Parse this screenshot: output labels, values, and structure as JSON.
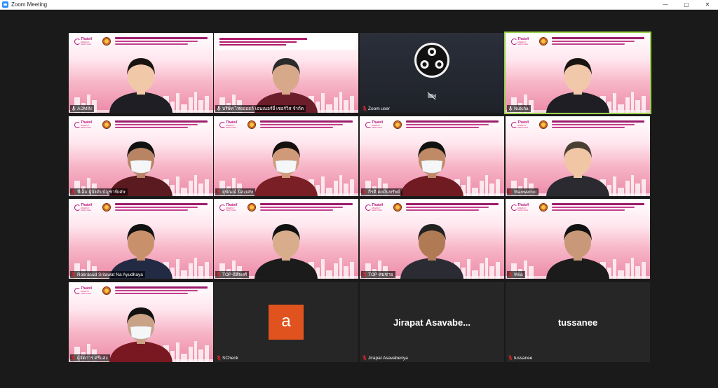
{
  "window": {
    "title": "Zoom Meeting",
    "controls": {
      "minimize": "—",
      "maximize": "▢",
      "close": "✕"
    }
  },
  "colors": {
    "active_speaker_border": "#9ad14b",
    "avatar_bg": "#e0531f",
    "brand_blue": "#2d8cff",
    "slide_magenta": "#b3167a"
  },
  "participants": [
    {
      "name": "ADMIN",
      "mic": "on",
      "video": "on",
      "icon": "mic-icon"
    },
    {
      "name": "บริษัท ไทยออยล์ เอนเนอร์ยี่ เซอร์วิส จำกัด",
      "mic": "on",
      "video": "on",
      "icon": "mic-icon"
    },
    {
      "name": "Zoom user",
      "mic": "muted",
      "video": "off",
      "icon": "mic-muted-icon"
    },
    {
      "name": "Nutcha",
      "mic": "on",
      "video": "on",
      "active": true,
      "icon": "mic-icon"
    },
    {
      "name": "ทีเอ็ม ผู้บังคับบัญชาพิเศษ",
      "mic": "muted",
      "video": "on",
      "icon": "mic-muted-icon"
    },
    {
      "name": "ยุพิณณ์ นิลงเศษ",
      "mic": "muted",
      "video": "on",
      "icon": "mic-muted-icon"
    },
    {
      "name": "กีรติ คงมั่นทรัพย์",
      "mic": "muted",
      "video": "on",
      "icon": "mic-muted-icon"
    },
    {
      "name": "Wanwemol",
      "mic": "muted",
      "video": "on",
      "icon": "mic-muted-icon"
    },
    {
      "name": "Roerasud Sritawat Na Ayudhaya",
      "mic": "muted",
      "video": "on",
      "icon": "mic-muted-icon"
    },
    {
      "name": "TOP-ธิติพงศ์",
      "mic": "muted",
      "video": "on",
      "icon": "mic-muted-icon"
    },
    {
      "name": "TOP-สมชาย",
      "mic": "muted",
      "video": "on",
      "icon": "mic-muted-icon"
    },
    {
      "name": "Wila",
      "mic": "muted",
      "video": "on",
      "icon": "mic-muted-icon"
    },
    {
      "name": "ผู้จัดการ ศรีแสง",
      "mic": "muted",
      "video": "on",
      "icon": "mic-muted-icon"
    },
    {
      "name": "SCheck",
      "mic": "muted",
      "video": "off",
      "avatar_letter": "a",
      "icon": "mic-muted-icon"
    },
    {
      "name": "Jirapat Asavabenya",
      "display_name": "Jirapat Asavabe...",
      "mic": "muted",
      "video": "off",
      "icon": "mic-muted-icon"
    },
    {
      "name": "tussanee",
      "display_name": "tussanee",
      "mic": "muted",
      "video": "off",
      "icon": "mic-muted-icon"
    }
  ],
  "slide": {
    "logo_line1": "Thaioil",
    "logo_line2": "ENERGY SERVICES"
  }
}
